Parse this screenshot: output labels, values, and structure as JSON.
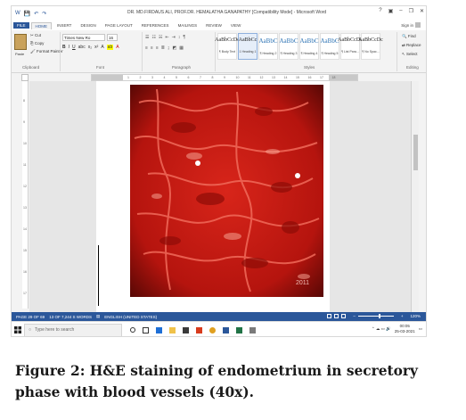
{
  "window": {
    "title": "DR. MD.FIRDAUS ALI, PROF.DR. HEMALATHA GANAPATHY [Compatibility Mode] - Microsoft Word",
    "controls": [
      "?",
      "▣",
      "–",
      "❐",
      "✕"
    ]
  },
  "qat": [
    "W",
    "💾",
    "↶",
    "↷"
  ],
  "ribbon": {
    "tabs": [
      "FILE",
      "HOME",
      "INSERT",
      "DESIGN",
      "PAGE LAYOUT",
      "REFERENCES",
      "MAILINGS",
      "REVIEW",
      "VIEW"
    ],
    "active_tab": "HOME",
    "sign_in": "Sign in",
    "clipboard": {
      "paste": "Paste",
      "cut": "Cut",
      "copy": "Copy",
      "format_painter": "Format Painter",
      "label": "Clipboard"
    },
    "font": {
      "name": "Times New Ro",
      "size": "16",
      "label": "Font"
    },
    "paragraph": {
      "label": "Paragraph"
    },
    "styles": {
      "label": "Styles",
      "items": [
        {
          "sample": "AaBbCcDc",
          "name": "¶ Body Text"
        },
        {
          "sample": "AaBbCc",
          "name": "1 Heading 1"
        },
        {
          "sample": "AaBbC",
          "name": "¶ Heading 2"
        },
        {
          "sample": "AaBbC",
          "name": "¶ Heading 3"
        },
        {
          "sample": "AaBbC",
          "name": "¶ Heading 4"
        },
        {
          "sample": "AaBbC",
          "name": "¶ Heading 5"
        },
        {
          "sample": "AaBbCcDc",
          "name": "¶ List Para..."
        },
        {
          "sample": "AaBbCcDc",
          "name": "¶ No Spac..."
        }
      ]
    },
    "editing": {
      "find": "Find",
      "replace": "Replace",
      "select": "Select",
      "label": "Editing"
    }
  },
  "ruler": {
    "h_ticks": [
      "1",
      "2",
      "3",
      "4",
      "5",
      "6",
      "7",
      "8",
      "9",
      "10",
      "11",
      "12",
      "13",
      "14",
      "15",
      "16",
      "17",
      "18"
    ],
    "v_ticks": [
      "8",
      "9",
      "10",
      "11",
      "12",
      "13",
      "14",
      "15",
      "16",
      "17"
    ]
  },
  "document": {
    "image_watermark": "2011"
  },
  "statusbar": {
    "page": "PAGE 29 OF 69",
    "words": "13 OF 7,244 S WORDS",
    "lang": "ENGLISH (UNITED STATES)",
    "zoom": "120%",
    "zoom_level": 0.62
  },
  "taskbar": {
    "search_placeholder": "Type here to search",
    "time": "00:05",
    "date": "25-03-2021",
    "tray": "⌃ ☁ ▭ 🔊"
  },
  "caption": "Figure 2: H&E staining of endometrium in secretory phase with blood vessels (40x)."
}
